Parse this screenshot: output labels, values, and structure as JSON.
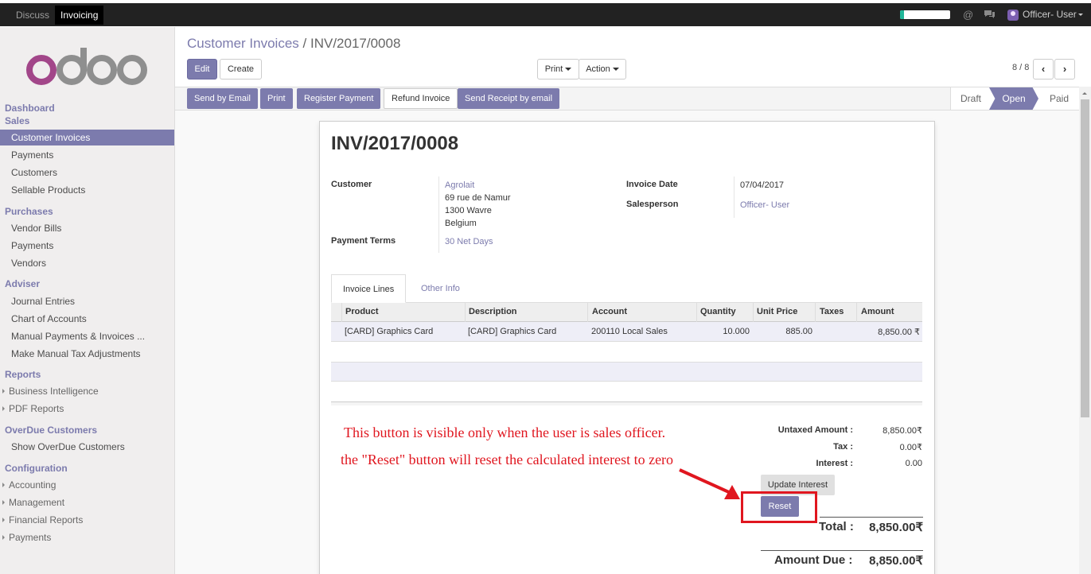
{
  "topbar": {
    "apps": [
      "Discuss",
      "Invoicing"
    ],
    "progress": 0.08,
    "user": "Officer- User"
  },
  "sidebar": {
    "sections": {
      "dashboard": "Dashboard",
      "sales": "Sales",
      "purchases": "Purchases",
      "adviser": "Adviser",
      "reports": "Reports",
      "overdue": "OverDue Customers",
      "configuration": "Configuration"
    },
    "sales_items": [
      "Customer Invoices",
      "Payments",
      "Customers",
      "Sellable Products"
    ],
    "purchase_items": [
      "Vendor Bills",
      "Payments",
      "Vendors"
    ],
    "adviser_items": [
      "Journal Entries",
      "Chart of Accounts",
      "Manual Payments & Invoices ...",
      "Make Manual Tax Adjustments"
    ],
    "report_items": [
      "Business Intelligence",
      "PDF Reports"
    ],
    "overdue_items": [
      "Show OverDue Customers"
    ],
    "config_items": [
      "Accounting",
      "Management",
      "Financial Reports",
      "Payments"
    ]
  },
  "breadcrumb": {
    "parent": "Customer Invoices",
    "sep": "/",
    "current": "INV/2017/0008"
  },
  "toolbar": {
    "edit": "Edit",
    "create": "Create",
    "print": "Print",
    "action": "Action",
    "pager": "8 / 8"
  },
  "statusbar": {
    "buttons": [
      "Send by Email",
      "Print",
      "Register Payment",
      "Refund Invoice",
      "Send Receipt by email"
    ],
    "stages": [
      "Draft",
      "Open",
      "Paid"
    ]
  },
  "invoice": {
    "number": "INV/2017/0008",
    "customer_label": "Customer",
    "customer_name": "Agrolait",
    "address": [
      "69 rue de Namur",
      "1300 Wavre",
      "Belgium"
    ],
    "payment_terms_label": "Payment Terms",
    "payment_terms": "30 Net Days",
    "invoice_date_label": "Invoice Date",
    "invoice_date": "07/04/2017",
    "salesperson_label": "Salesperson",
    "salesperson": "Officer- User"
  },
  "tabs": [
    "Invoice Lines",
    "Other Info"
  ],
  "lines": {
    "headers": [
      "Product",
      "Description",
      "Account",
      "Quantity",
      "Unit Price",
      "Taxes",
      "Amount"
    ],
    "row": [
      "[CARD] Graphics Card",
      "[CARD] Graphics Card",
      "200110 Local Sales",
      "10.000",
      "885.00",
      "",
      "8,850.00 ₹"
    ]
  },
  "annotation": {
    "line1": "This button is visible only when the user is sales officer.",
    "line2": "the \"Reset\" button will reset the calculated interest to zero"
  },
  "totals": {
    "untaxed_label": "Untaxed Amount :",
    "untaxed": "8,850.00₹",
    "tax_label": "Tax :",
    "tax": "0.00₹",
    "interest_label": "Interest :",
    "interest": "0.00",
    "update_interest": "Update Interest",
    "reset": "Reset",
    "total_label": "Total :",
    "total": "8,850.00₹",
    "amount_due_label": "Amount Due :",
    "amount_due": "8,850.00₹"
  },
  "colors": {
    "accent": "#7c7bad",
    "annotation": "#e0161f",
    "progress": "#21b799"
  }
}
